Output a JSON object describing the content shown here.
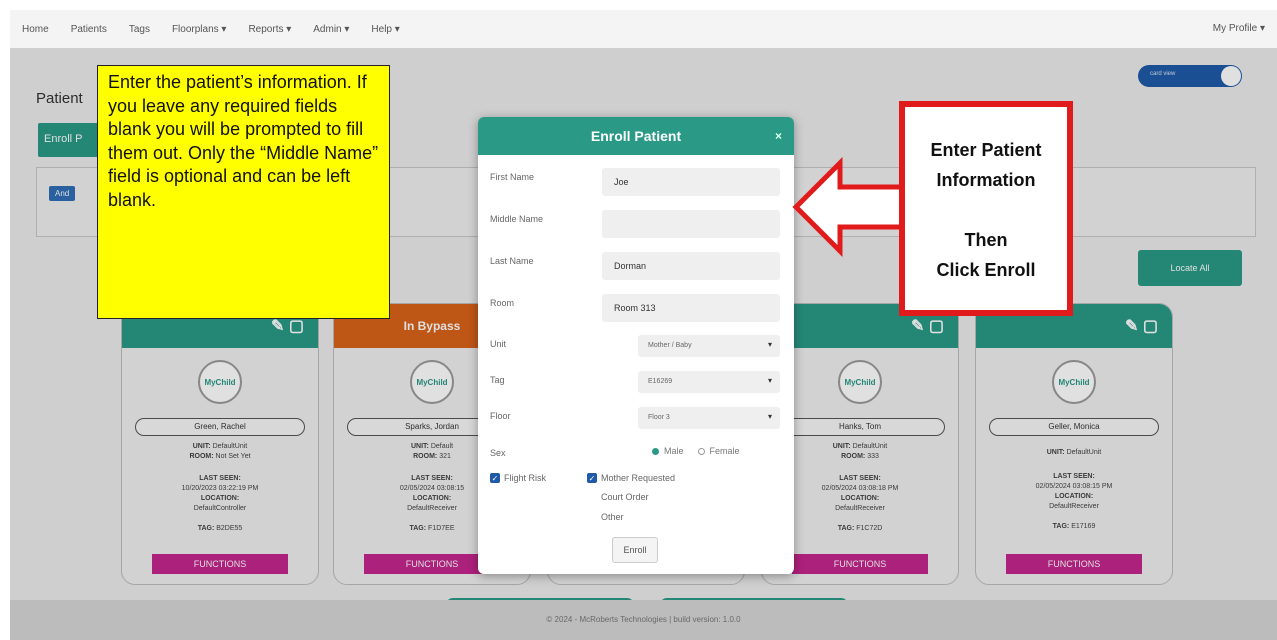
{
  "nav": {
    "items": [
      "Home",
      "Patients",
      "Tags",
      "Floorplans ▾",
      "Reports ▾",
      "Admin ▾",
      "Help ▾"
    ],
    "profile": "My Profile ▾"
  },
  "page": {
    "title": "Patient",
    "enroll_button": "Enroll P",
    "and_chip": "And",
    "locate_all": "Locate All",
    "toggle_label": "card view"
  },
  "cards": [
    {
      "header": "",
      "name": "Green, Rachel",
      "unit_label": "UNIT:",
      "unit": "DefaultUnit",
      "room_label": "ROOM:",
      "room": "Not Set Yet",
      "last_seen_label": "LAST SEEN:",
      "last_seen": "10/20/2023 03:22:19 PM",
      "location_label": "LOCATION:",
      "location": "DefaultController",
      "tag_label": "TAG:",
      "tag": "B2DE55",
      "functions": "FUNCTIONS"
    },
    {
      "header": "In Bypass",
      "name": "Sparks, Jordan",
      "unit_label": "UNIT:",
      "unit": "Default",
      "room_label": "ROOM:",
      "room": "321",
      "last_seen_label": "LAST SEEN:",
      "last_seen": "02/05/2024 03:08:15",
      "location_label": "LOCATION:",
      "location": "DefaultReceiver",
      "tag_label": "TAG:",
      "tag": "F1D7EE",
      "functions": "FUNCTIONS"
    },
    {
      "header": "",
      "name": "Hanks, Tom",
      "unit_label": "UNIT:",
      "unit": "DefaultUnit",
      "room_label": "ROOM:",
      "room": "333",
      "last_seen_label": "LAST SEEN:",
      "last_seen": "02/05/2024 03:08:18 PM",
      "location_label": "LOCATION:",
      "location": "DefaultReceiver",
      "tag_label": "TAG:",
      "tag": "F1C72D",
      "functions": "FUNCTIONS"
    },
    {
      "header": "",
      "name": "Geller, Monica",
      "unit_label": "UNIT:",
      "unit": "DefaultUnit",
      "room_label": "",
      "room": "",
      "last_seen_label": "LAST SEEN:",
      "last_seen": "02/05/2024 03:08:15 PM",
      "location_label": "LOCATION:",
      "location": "DefaultReceiver",
      "tag_label": "TAG:",
      "tag": "E17169",
      "functions": "FUNCTIONS"
    }
  ],
  "modal": {
    "title": "Enroll Patient",
    "close": "×",
    "first_name_label": "First Name",
    "first_name_value": "Joe",
    "middle_name_label": "Middle Name",
    "middle_name_value": "",
    "last_name_label": "Last Name",
    "last_name_value": "Dorman",
    "room_label": "Room",
    "room_value": "Room 313",
    "unit_label": "Unit",
    "unit_value": "Mother / Baby",
    "tag_label": "Tag",
    "tag_value": "E16269",
    "floor_label": "Floor",
    "floor_value": "Floor 3",
    "sex_label": "Sex",
    "sex_male": "Male",
    "sex_female": "Female",
    "flight_risk": "Flight Risk",
    "mother_requested": "Mother Requested",
    "court_order": "Court Order",
    "other": "Other",
    "enroll_button": "Enroll"
  },
  "footer": "© 2024 - McRoberts Technologies | build version: 1.0.0",
  "annotations": {
    "yellow_note": "Enter the patient’s information. If you leave any required fields blank you will be prompted to fill them out. Only the “Middle Name” field is optional and can be left blank.",
    "red_line1": "Enter Patient",
    "red_line2": "Information",
    "red_line3": "Then",
    "red_line4": "Click Enroll"
  },
  "colors": {
    "teal": "#2a9a87",
    "bypass_orange": "#d9621a",
    "functions_magenta": "#c4268d",
    "note_yellow": "#ffff00",
    "note_red": "#e11b1b"
  },
  "icons": [
    "edit-icon",
    "document-icon",
    "stork-logo-icon",
    "chevron-down-icon",
    "close-icon",
    "arrow-left-icon"
  ]
}
